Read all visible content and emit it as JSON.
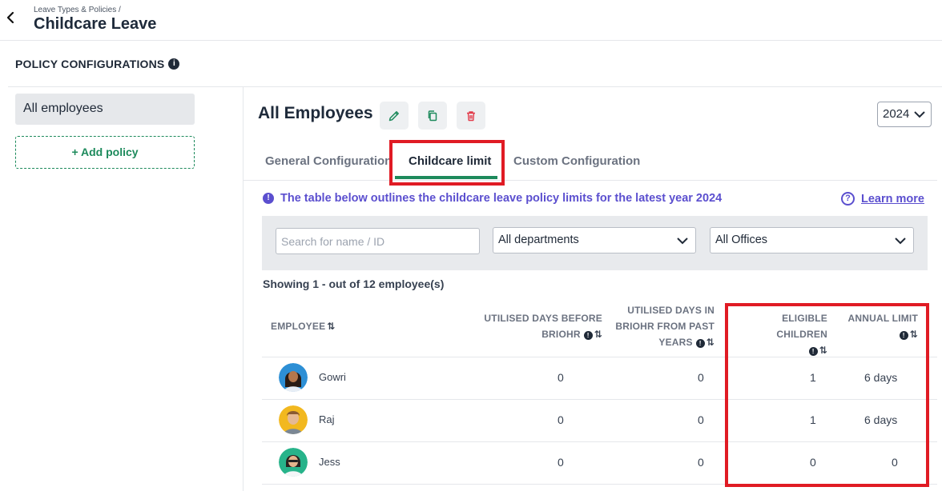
{
  "header": {
    "breadcrumb": "Leave Types & Policies  /",
    "title": "Childcare Leave"
  },
  "section": {
    "title": "POLICY CONFIGURATIONS"
  },
  "sidebar": {
    "policies": [
      {
        "label": "All employees"
      }
    ],
    "add_policy_label": "+ Add policy"
  },
  "main": {
    "title": "All Employees",
    "year": "2024",
    "tabs": [
      {
        "label": "General Configuration"
      },
      {
        "label": "Childcare limit",
        "active": true
      },
      {
        "label": "Custom Configuration"
      }
    ],
    "notice": "The table below outlines the childcare leave policy limits for the latest year 2024",
    "learn_more": "Learn more",
    "filters": {
      "search_placeholder": "Search for name / ID",
      "department": "All departments",
      "office": "All Offices"
    },
    "showing": "Showing 1 - out of 12 employee(s)",
    "table": {
      "headers": {
        "employee": "EMPLOYEE",
        "utilised_before_1": "UTILISED DAYS BEFORE",
        "utilised_before_2": "BRIOHR",
        "utilised_past_1": "UTILISED DAYS IN",
        "utilised_past_2": "BRIOHR FROM PAST",
        "utilised_past_3": "YEARS",
        "eligible_children": "ELIGIBLE CHILDREN",
        "annual_limit": "ANNUAL LIMIT"
      },
      "rows": [
        {
          "name": "Gowri",
          "utilised_before": "0",
          "utilised_past": "0",
          "eligible_children": "1",
          "annual_limit": "6 days"
        },
        {
          "name": "Raj",
          "utilised_before": "0",
          "utilised_past": "0",
          "eligible_children": "1",
          "annual_limit": "6 days"
        },
        {
          "name": "Jess",
          "utilised_before": "0",
          "utilised_past": "0",
          "eligible_children": "0",
          "annual_limit": "0"
        }
      ]
    }
  },
  "icons": {
    "back": "chevron-left-icon",
    "info": "info-icon",
    "edit": "pencil-icon",
    "copy": "copy-icon",
    "delete": "trash-icon",
    "help": "question-icon",
    "sort": "sort-icon"
  },
  "colors": {
    "accent_green": "#1d8a5c",
    "notice_purple": "#5b4fcf",
    "highlight_red": "#e01b24",
    "delete_red": "#e23b4a"
  }
}
